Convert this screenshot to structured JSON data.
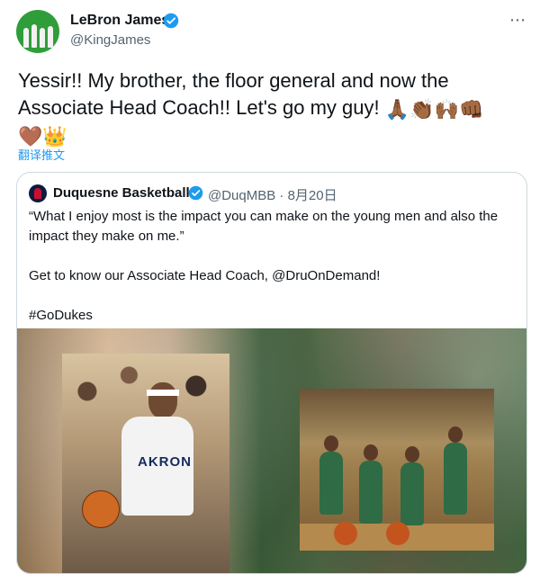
{
  "author": {
    "name": "LeBron James",
    "handle": "@KingJames"
  },
  "tweet": {
    "text_line1": "Yessir!! My brother, the floor general and now the",
    "text_line2": "Associate Head Coach!! Let's go my guy!",
    "emojis_line2": [
      "🙏🏾",
      "👏🏾",
      "🙌🏾",
      "👊🏾"
    ],
    "emojis_line3": [
      "🤎",
      "👑"
    ],
    "translate_label": "翻译推文"
  },
  "quote": {
    "name": "Duquesne Basketball",
    "handle": "@DuqMBB",
    "separator": "·",
    "date": "8月20日",
    "paragraph1": "“What I enjoy most is the impact you can make on the young men and also the impact they make on me.”",
    "paragraph2": "Get to know our Associate Head Coach, @DruOnDemand!",
    "paragraph3": "#GoDukes",
    "media_jersey_text": "AKRON"
  },
  "icons": {
    "more": "more-horizontal-icon",
    "verified": "verified-badge-icon"
  },
  "colors": {
    "accent": "#1d9bf0",
    "secondary_text": "#536471",
    "border": "#cfd9de"
  }
}
